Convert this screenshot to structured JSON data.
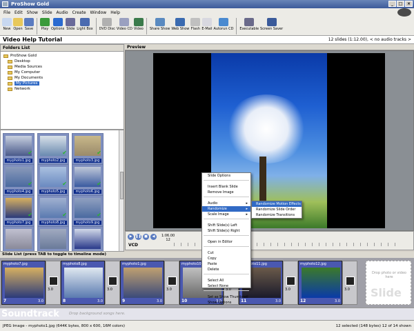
{
  "window": {
    "title": "ProShow Gold",
    "min": "_",
    "max": "□",
    "close": "×"
  },
  "menu": [
    "File",
    "Edit",
    "Show",
    "Slide",
    "Audio",
    "Create",
    "Window",
    "Help"
  ],
  "toolbar": [
    {
      "label": "New",
      "color": "#c8d8f0"
    },
    {
      "label": "Open",
      "color": "#e8c85a"
    },
    {
      "label": "Save",
      "color": "#5a7bc0"
    },
    {
      "label": "Play",
      "color": "#3a9a3a"
    },
    {
      "label": "Options",
      "color": "#2a6ad0"
    },
    {
      "label": "Slide",
      "color": "#6a6a9a"
    },
    {
      "label": "Light Box",
      "color": "#4a6ab0"
    },
    {
      "label": "DVD Disc",
      "color": "#b0b0b0"
    },
    {
      "label": "Video CD",
      "color": "#9aa0c0"
    },
    {
      "label": "Video",
      "color": "#3a7a4a"
    },
    {
      "label": "Share Show",
      "color": "#5a8ac0"
    },
    {
      "label": "Web Show",
      "color": "#3a6ab0"
    },
    {
      "label": "Flash",
      "color": "#c0c0c0"
    },
    {
      "label": "E-Mail",
      "color": "#d8d8e0"
    },
    {
      "label": "Autorun CD",
      "color": "#4a8ad0"
    },
    {
      "label": "Executable",
      "color": "#6a6a8a"
    },
    {
      "label": "Screen Saver",
      "color": "#3a5a9a"
    }
  ],
  "project": {
    "title": "Video Help Tutorial",
    "info": "12 slides (1:12.00), < no audio tracks >"
  },
  "folders": {
    "header": "Folders List",
    "items": [
      {
        "label": "ProShow Gold",
        "selected": false
      },
      {
        "label": "Desktop",
        "selected": false
      },
      {
        "label": "Media Sources",
        "selected": false
      },
      {
        "label": "My Computer",
        "selected": false
      },
      {
        "label": "My Documents",
        "selected": false
      },
      {
        "label": "My Pictures",
        "selected": true
      },
      {
        "label": "Network",
        "selected": false
      }
    ]
  },
  "thumbs": [
    {
      "name": "myphoto1.jpg",
      "c1": "#4a5a8a",
      "c2": "#c8d0e0"
    },
    {
      "name": "myphoto2.jpg",
      "c1": "#6a8ab0",
      "c2": "#d8e0e8"
    },
    {
      "name": "myphoto3.jpg",
      "c1": "#9a8a6a",
      "c2": "#c8b88a"
    },
    {
      "name": "myphoto4.jpg",
      "c1": "#4a6aa0",
      "c2": "#8a9aba"
    },
    {
      "name": "myphoto5.jpg",
      "c1": "#6a8ac0",
      "c2": "#aac0e0"
    },
    {
      "name": "myphoto6.jpg",
      "c1": "#3a5aa0",
      "c2": "#c0c8d8"
    },
    {
      "name": "myphoto7.jpg",
      "c1": "#2a3a7a",
      "c2": "#d8b060"
    },
    {
      "name": "myphoto8.jpg",
      "c1": "#5a7ab0",
      "c2": "#a0b0d0"
    },
    {
      "name": "myphoto9.jpg",
      "c1": "#4a6aa0",
      "c2": "#90a0c0"
    },
    {
      "name": "",
      "c1": "#8a8a9a",
      "c2": "#c0c0d0"
    },
    {
      "name": "",
      "c1": "#6a7a9a",
      "c2": "#a0aac0"
    },
    {
      "name": "",
      "c1": "#2a3a8a",
      "c2": "#d0d8e8"
    }
  ],
  "preview_header": "Preview",
  "timebar": {
    "timecode": "1:06.00",
    "slide_no": "12",
    "format": "VCD"
  },
  "context_menu": [
    {
      "label": "Slide Options"
    },
    {
      "label": "sep"
    },
    {
      "label": "Insert Blank Slide"
    },
    {
      "label": "Remove Image"
    },
    {
      "label": "sep"
    },
    {
      "label": "Audio",
      "arrow": "▸"
    },
    {
      "label": "Randomize",
      "arrow": "▸",
      "hl": true
    },
    {
      "label": "Scale Image",
      "arrow": "▸"
    },
    {
      "label": "sep"
    },
    {
      "label": "Shift Slide(s) Left"
    },
    {
      "label": "Shift Slide(s) Right"
    },
    {
      "label": "sep"
    },
    {
      "label": "Open in Editor"
    },
    {
      "label": "sep"
    },
    {
      "label": "Cut"
    },
    {
      "label": "Copy"
    },
    {
      "label": "Paste"
    },
    {
      "label": "Delete"
    },
    {
      "label": "sep"
    },
    {
      "label": "Select All"
    },
    {
      "label": "Select None"
    },
    {
      "label": "sep"
    },
    {
      "label": "Set as Show Thumbnail"
    },
    {
      "label": "Show Options"
    }
  ],
  "submenu": [
    {
      "label": "Randomize Motion Effects",
      "hl": true
    },
    {
      "label": "Randomize Slide Order"
    },
    {
      "label": "Randomize Transitions"
    }
  ],
  "slidelist": {
    "header": "Slide List (press TAB to toggle to timeline mode)",
    "slides": [
      {
        "name": "myphoto7.jpg",
        "no": "7",
        "dur": "3.0",
        "c1": "#2a3a7a",
        "c2": "#d8b060",
        "sel": true
      },
      {
        "name": "myphoto8.jpg",
        "no": "8",
        "dur": "3.0",
        "c1": "#5a7ab0",
        "c2": "#e0e8f0",
        "sel": true
      },
      {
        "name": "myphoto1.jpg",
        "no": "9",
        "dur": "3.0",
        "c1": "#3a4a7a",
        "c2": "#c0a070",
        "sel": true
      },
      {
        "name": "myphoto10.jpg",
        "no": "10",
        "dur": "3.0",
        "c1": "#6a6a6a",
        "c2": "#c0c0c0",
        "sel": true
      },
      {
        "name": "myphoto11.jpg",
        "no": "11",
        "dur": "3.0",
        "c1": "#1a1a2a",
        "c2": "#6a5a4a",
        "sel": true
      },
      {
        "name": "myphoto12.jpg",
        "no": "12",
        "dur": "3.0",
        "c1": "#0a3aa8",
        "c2": "#3c7a2a",
        "sel": true
      }
    ],
    "trans_dur": "3.0",
    "empty_hint": "Drop photo or video here",
    "empty_big": "Slide"
  },
  "soundtrack": {
    "label": "Soundtrack",
    "hint": "Drop background songs here."
  },
  "status": {
    "left": "JPEG Image - myphoto1.jpg  (644K bytes, 800 x 600, 16M colors)",
    "right": "12 selected (148 bytes) 12 of 14 shown"
  }
}
